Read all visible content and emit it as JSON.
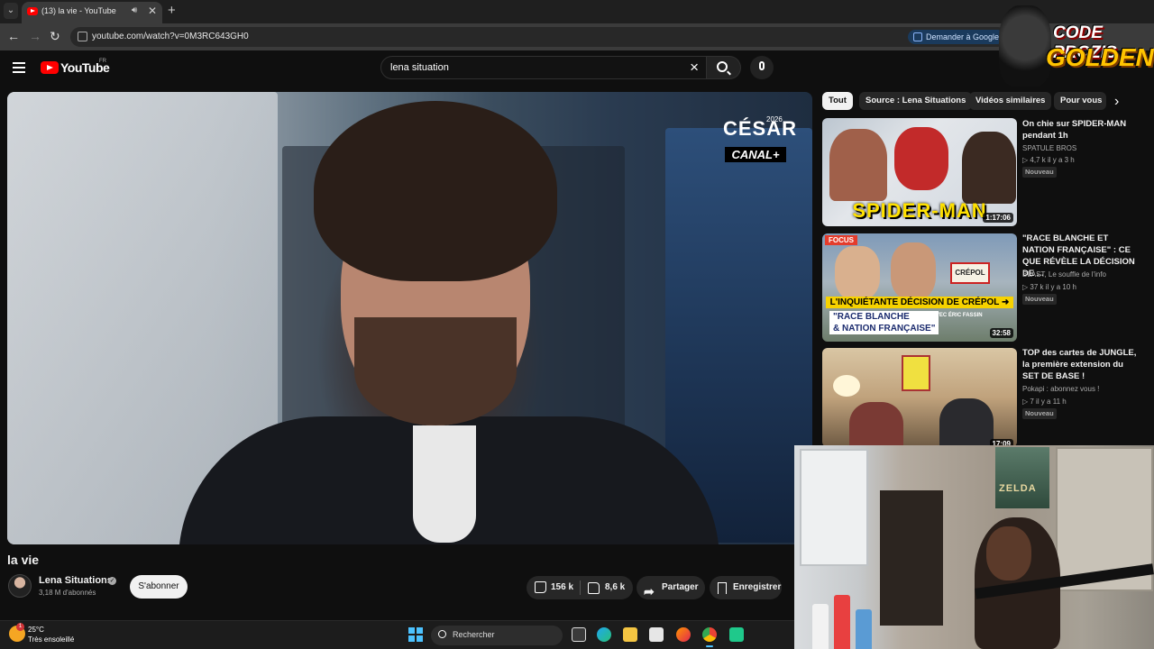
{
  "browser": {
    "tab_title": "(13) la vie - YouTube",
    "url": "youtube.com/watch?v=0M3RC643GH0",
    "ask_google": "Demander à Google"
  },
  "header": {
    "logo_text": "YouTube",
    "region": "FR",
    "search_query": "lena situation"
  },
  "video": {
    "title": "la vie",
    "overlay_brand": "CÉSAR",
    "overlay_year": "2026",
    "overlay_channel": "CANAL+",
    "channel_name": "Lena Situations",
    "subscribers": "3,18 M d'abonnés",
    "subscribe_label": "S'abonner",
    "likes": "156 k",
    "dislikes": "8,6 k",
    "share_label": "Partager",
    "save_label": "Enregistrer"
  },
  "sidebar": {
    "chips": [
      "Tout",
      "Source : Lena Situations",
      "Vidéos similaires",
      "Pour vous"
    ],
    "items": [
      {
        "title": "On chie sur SPIDER-MAN pendant 1h",
        "channel": "SPATULE BROS",
        "meta": "▷ 4,7 k  il y a 3 h",
        "badge": "Nouveau",
        "duration": "1:17:06",
        "thumb_text": "SPIDER-MAN"
      },
      {
        "title": "\"RACE BLANCHE ET NATION FRANÇAISE\" : CE QUE RÉVÈLE LA DÉCISION DE ...",
        "channel": "BLAST, Le souffle de l'info",
        "meta": "▷ 37 k  il y a 10 h",
        "badge": "Nouveau",
        "duration": "32:58",
        "thumb_focus": "FOCUS",
        "thumb_sign": "CRÉPOL",
        "thumb_line1": "L'INQUIÉTANTE DÉCISION DE CRÉPOL ➜",
        "thumb_line2a": "\"RACE BLANCHE",
        "thumb_line2b": "& NATION FRANÇAISE\"",
        "thumb_sub": "AVEC ÉRIC FASSIN"
      },
      {
        "title": "TOP des cartes de JUNGLE, la première extension du SET DE BASE !",
        "channel": "Pokapi : abonnez vous !",
        "meta": "▷ 7  il y a 11 h",
        "badge": "Nouveau",
        "duration": "17:09"
      }
    ]
  },
  "overlay": {
    "brand_line1": "CODE PROZIS",
    "brand_line2": "GOLDENG",
    "webcam_poster": "ZELDA"
  },
  "taskbar": {
    "temperature": "25°C",
    "weather": "Très ensoleillé",
    "weather_badge": "1",
    "search_label": "Rechercher"
  }
}
